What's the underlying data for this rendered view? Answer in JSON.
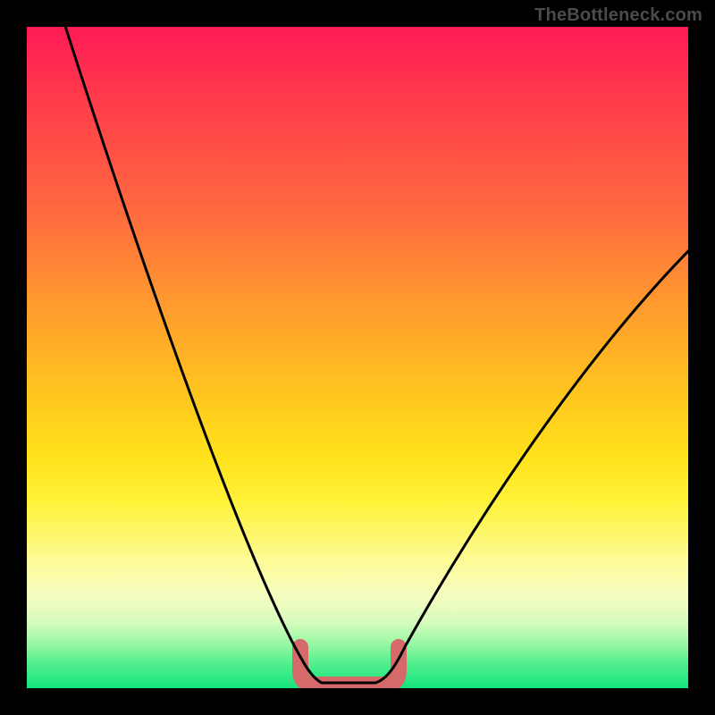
{
  "watermark": "TheBottleneck.com",
  "chart_data": {
    "type": "line",
    "title": "",
    "xlabel": "",
    "ylabel": "",
    "xlim": [
      0,
      100
    ],
    "ylim": [
      0,
      100
    ],
    "grid": false,
    "legend": false,
    "annotations": [],
    "x": [
      0,
      5,
      10,
      15,
      20,
      25,
      30,
      35,
      40,
      43,
      46,
      49,
      52,
      55,
      60,
      65,
      70,
      75,
      80,
      85,
      90,
      95,
      100
    ],
    "series": [
      {
        "name": "bottleneck-curve",
        "color": "#000000",
        "values": [
          100,
          89,
          78,
          67,
          56,
          45,
          34,
          23,
          12,
          4,
          0,
          0,
          0,
          4,
          13,
          22,
          30,
          38,
          45,
          51,
          57,
          62,
          67
        ]
      }
    ],
    "highlight": {
      "name": "valley-marker",
      "color": "#d66a6a",
      "x_range": [
        43,
        55
      ],
      "y": 0
    },
    "background_gradient": {
      "direction": "vertical",
      "stops": [
        {
          "pos": 0.0,
          "color": "#ff1a55"
        },
        {
          "pos": 0.28,
          "color": "#ff6a3f"
        },
        {
          "pos": 0.55,
          "color": "#ffc41f"
        },
        {
          "pos": 0.8,
          "color": "#fdfb90"
        },
        {
          "pos": 1.0,
          "color": "#14e37b"
        }
      ]
    }
  }
}
